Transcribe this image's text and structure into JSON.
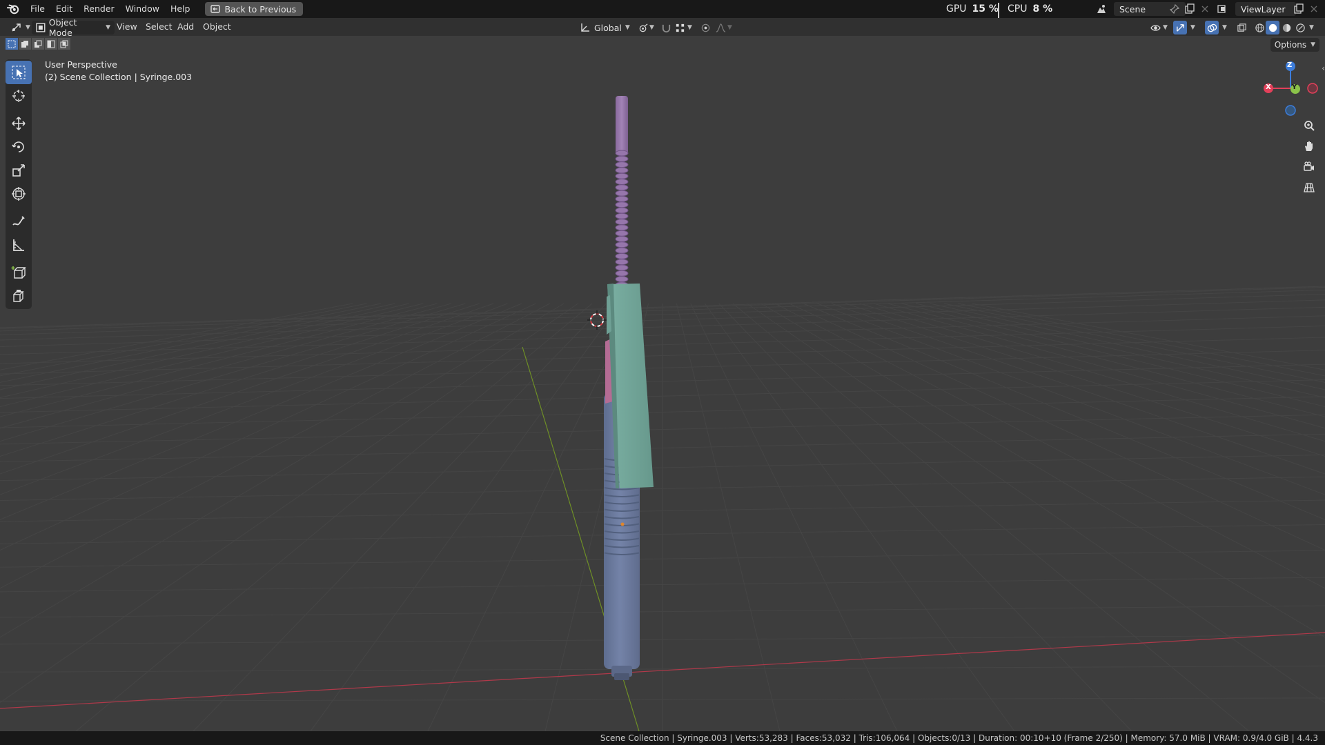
{
  "menubar": {
    "logo_icon": "blender-logo-icon",
    "items": [
      "File",
      "Edit",
      "Render",
      "Window",
      "Help"
    ],
    "back_button": "Back to Previous"
  },
  "stats": {
    "gpu_label": "GPU",
    "gpu_value": "15 %",
    "cpu_label": "CPU",
    "cpu_value": "8 %"
  },
  "scene": {
    "name": "Scene",
    "view_layer": "ViewLayer"
  },
  "viewport_header": {
    "mode": "Object Mode",
    "menus": [
      "View",
      "Select",
      "Add",
      "Object"
    ],
    "orientation": "Global",
    "options": "Options"
  },
  "viewport": {
    "perspective": "User Perspective",
    "collection_info": "(2) Scene Collection | Syringe.003"
  },
  "gizmo": {
    "z": "Z",
    "y": "Y",
    "x": "X"
  },
  "statusbar": {
    "text": "Scene Collection | Syringe.003 | Verts:53,283 | Faces:53,032 | Tris:106,064 | Objects:0/13 | Duration: 00:10+10 (Frame 2/250) | Memory: 57.0 MiB | VRAM: 0.9/4.0 GiB | 4.4.3"
  },
  "colors": {
    "accent": "#4772b3",
    "axis_x": "#e3405a",
    "axis_y": "#8bc34a",
    "axis_z": "#3d7ddb",
    "plunger": "#9b7bb0",
    "barrel": "#6f7fa3",
    "label_panel": "#6fa095"
  }
}
